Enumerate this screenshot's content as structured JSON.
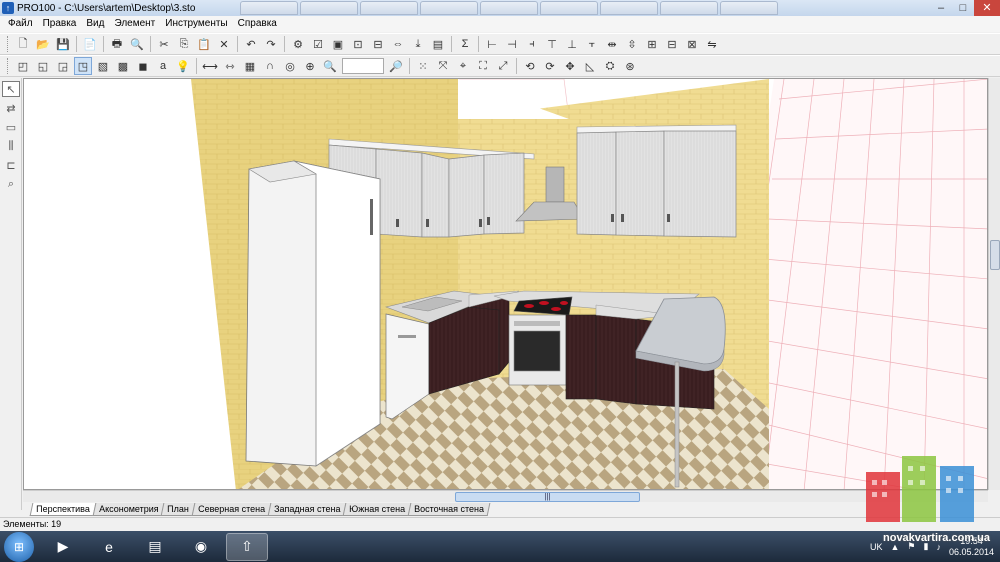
{
  "window": {
    "title": "PRO100 - C:\\Users\\artem\\Desktop\\3.sto",
    "minimize": "–",
    "maximize": "□",
    "close": "✕"
  },
  "menu": {
    "items": [
      {
        "label": "Файл"
      },
      {
        "label": "Правка"
      },
      {
        "label": "Вид"
      },
      {
        "label": "Элемент"
      },
      {
        "label": "Инструменты"
      },
      {
        "label": "Справка"
      }
    ]
  },
  "toolbar1": {
    "icons": [
      {
        "name": "new-icon",
        "glyph": "🗋"
      },
      {
        "name": "open-icon",
        "glyph": "📂"
      },
      {
        "name": "save-icon",
        "glyph": "💾"
      },
      {
        "name": "properties-icon",
        "glyph": "📄"
      },
      {
        "name": "print-icon",
        "glyph": "🖶"
      },
      {
        "name": "print-preview-icon",
        "glyph": "🔍"
      },
      {
        "name": "cut-icon",
        "glyph": "✂"
      },
      {
        "name": "copy-icon",
        "glyph": "⎘"
      },
      {
        "name": "paste-icon",
        "glyph": "📋"
      },
      {
        "name": "delete-icon",
        "glyph": "✕"
      },
      {
        "name": "undo-icon",
        "glyph": "↶"
      },
      {
        "name": "redo-icon",
        "glyph": "↷"
      },
      {
        "name": "settings-icon",
        "glyph": "⚙"
      },
      {
        "name": "report-icon",
        "glyph": "☑"
      },
      {
        "name": "view-front-icon",
        "glyph": "▣"
      },
      {
        "name": "view-zoom-icon",
        "glyph": "⊡"
      },
      {
        "name": "view-fit-icon",
        "glyph": "⊟"
      },
      {
        "name": "view-width-icon",
        "glyph": "⇔"
      },
      {
        "name": "view-export-icon",
        "glyph": "⤓"
      },
      {
        "name": "view-render-icon",
        "glyph": "▤"
      },
      {
        "name": "sum-icon",
        "glyph": "Σ"
      },
      {
        "name": "align-left-icon",
        "glyph": "⊢"
      },
      {
        "name": "align-center-icon",
        "glyph": "⊣"
      },
      {
        "name": "align-right-icon",
        "glyph": "⫞"
      },
      {
        "name": "align-top-icon",
        "glyph": "⊤"
      },
      {
        "name": "align-middle-icon",
        "glyph": "⊥"
      },
      {
        "name": "align-bottom-icon",
        "glyph": "⫟"
      },
      {
        "name": "distribute-h-icon",
        "glyph": "⇹"
      },
      {
        "name": "distribute-v-icon",
        "glyph": "⇳"
      },
      {
        "name": "group-icon",
        "glyph": "⊞"
      },
      {
        "name": "ungroup-icon",
        "glyph": "⊟"
      },
      {
        "name": "lock-icon",
        "glyph": "⊠"
      },
      {
        "name": "mirror-icon",
        "glyph": "⇋"
      }
    ]
  },
  "toolbar2": {
    "icons_a": [
      {
        "name": "wireframe-view-icon",
        "glyph": "◰",
        "active": false
      },
      {
        "name": "hidden-lines-view-icon",
        "glyph": "◱",
        "active": false
      },
      {
        "name": "solid-view-icon",
        "glyph": "◲",
        "active": false
      },
      {
        "name": "textured-view-icon",
        "glyph": "◳",
        "active": true
      },
      {
        "name": "shaded-view-icon",
        "glyph": "▧",
        "active": false
      },
      {
        "name": "realistic-view-icon",
        "glyph": "▩",
        "active": false
      },
      {
        "name": "color-view-icon",
        "glyph": "◼",
        "active": false
      },
      {
        "name": "text-labels-icon",
        "glyph": "a",
        "active": false
      },
      {
        "name": "light-icon",
        "glyph": "💡",
        "active": false
      }
    ],
    "icons_b": [
      {
        "name": "dimension-icon",
        "glyph": "⟷"
      },
      {
        "name": "measure-icon",
        "glyph": "⇿"
      },
      {
        "name": "grid-icon",
        "glyph": "▦"
      },
      {
        "name": "magnet-icon",
        "glyph": "∩"
      },
      {
        "name": "snap-icon",
        "glyph": "◎"
      },
      {
        "name": "target-icon",
        "glyph": "⊕"
      },
      {
        "name": "zoom-in-icon",
        "glyph": "🔍"
      }
    ],
    "zoom_value": "",
    "icons_c": [
      {
        "name": "zoom-out-icon",
        "glyph": "🔎"
      },
      {
        "name": "dots-grid-icon",
        "glyph": "⁙"
      },
      {
        "name": "move-icon",
        "glyph": "⤧"
      },
      {
        "name": "pick-icon",
        "glyph": "⌖"
      },
      {
        "name": "frame-select-icon",
        "glyph": "⛶"
      },
      {
        "name": "fit-icon",
        "glyph": "⤢"
      },
      {
        "name": "rotate-x-icon",
        "glyph": "⟲"
      },
      {
        "name": "rotate-y-icon",
        "glyph": "⟳"
      },
      {
        "name": "move-cross-icon",
        "glyph": "✥"
      },
      {
        "name": "skew-icon",
        "glyph": "◺"
      },
      {
        "name": "camera-icon",
        "glyph": "⛭"
      },
      {
        "name": "lifebuoy-icon",
        "glyph": "⊛"
      }
    ]
  },
  "lefttools": [
    {
      "name": "select-tool-icon",
      "glyph": "↖",
      "active": true
    },
    {
      "name": "dimension-tool-icon",
      "glyph": "⇄",
      "active": false
    },
    {
      "name": "rectangle-tool-icon",
      "glyph": "▭",
      "active": false
    },
    {
      "name": "align-tool-icon",
      "glyph": "⫼",
      "active": false
    },
    {
      "name": "arrange-tool-icon",
      "glyph": "⊏",
      "active": false
    },
    {
      "name": "zoom-tool-icon",
      "glyph": "⌕",
      "active": false
    }
  ],
  "hscroll_thumb": "|||",
  "view_tabs": [
    {
      "label": "Перспектива",
      "active": true
    },
    {
      "label": "Аксонометрия",
      "active": false
    },
    {
      "label": "План",
      "active": false
    },
    {
      "label": "Северная стена",
      "active": false
    },
    {
      "label": "Западная стена",
      "active": false
    },
    {
      "label": "Южная стена",
      "active": false
    },
    {
      "label": "Восточная стена",
      "active": false
    }
  ],
  "status": {
    "elements": "Элементы: 19"
  },
  "taskbar": {
    "items": [
      {
        "name": "media-player-taskbar-icon",
        "glyph": "▶",
        "active": false
      },
      {
        "name": "ie-taskbar-icon",
        "glyph": "e",
        "active": false
      },
      {
        "name": "explorer-taskbar-icon",
        "glyph": "▤",
        "active": false
      },
      {
        "name": "chrome-taskbar-icon",
        "glyph": "◉",
        "active": false
      },
      {
        "name": "pro100-taskbar-icon",
        "glyph": "⇧",
        "active": true
      }
    ],
    "lang": "UK",
    "time": "19:54",
    "date": "06.05.2014"
  },
  "watermark": {
    "text": "novakvartira.com.ua"
  },
  "colors": {
    "wall": "#e6cf7c",
    "cabinet_light": "#dedede",
    "cabinet_dark": "#3a1e20",
    "floor_light": "#ece4cd",
    "floor_dark": "#b9a580",
    "grid_lines": "#e8a0a8"
  }
}
